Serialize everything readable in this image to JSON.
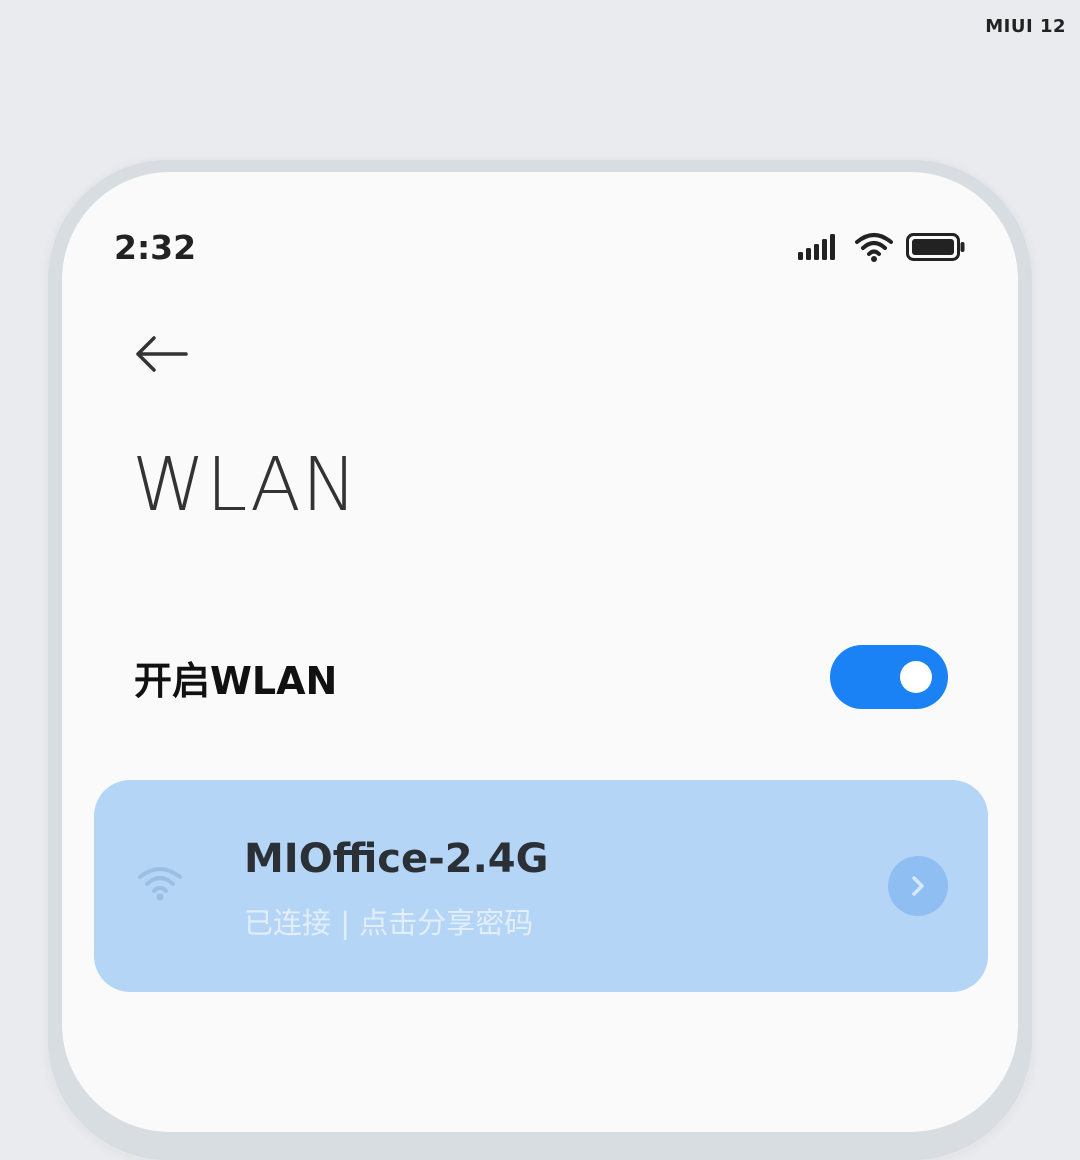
{
  "brand": "MIUI 12",
  "status_bar": {
    "time": "2:32",
    "icons": [
      "signal-icon",
      "wifi-icon",
      "battery-icon"
    ]
  },
  "header": {
    "back_icon": "arrow-left-icon",
    "title": "WLAN"
  },
  "wlan_toggle": {
    "label": "开启WLAN",
    "enabled": true
  },
  "connected_network": {
    "icon": "wifi-icon",
    "ssid": "MIOffice-2.4G",
    "status": "已连接 | 点击分享密码",
    "detail_icon": "chevron-right-icon"
  },
  "colors": {
    "accent": "#1a82f5",
    "card_bg": "#b5d5f6",
    "screen_bg": "#fafafa",
    "outer_bg": "#e9ebee"
  }
}
